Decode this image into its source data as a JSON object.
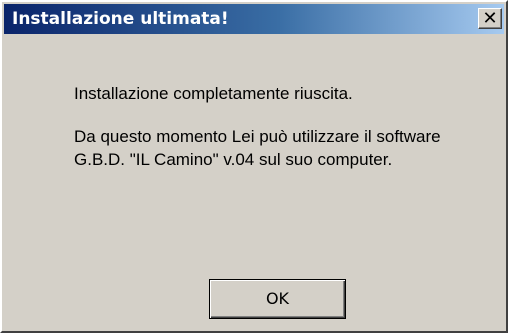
{
  "dialog": {
    "title": "Installazione ultimata!",
    "close_glyph": "✕",
    "close_icon": "close-icon",
    "message_line1": "Installazione completamente riuscita.",
    "message_line2": "Da questo momento Lei può utilizzare il software G.B.D. \"IL Camino\" v.04 sul suo computer.",
    "ok_label": "OK"
  },
  "colors": {
    "titlebar_start": "#0a246a",
    "titlebar_end": "#a6caf0",
    "face": "#d4d0c8"
  }
}
